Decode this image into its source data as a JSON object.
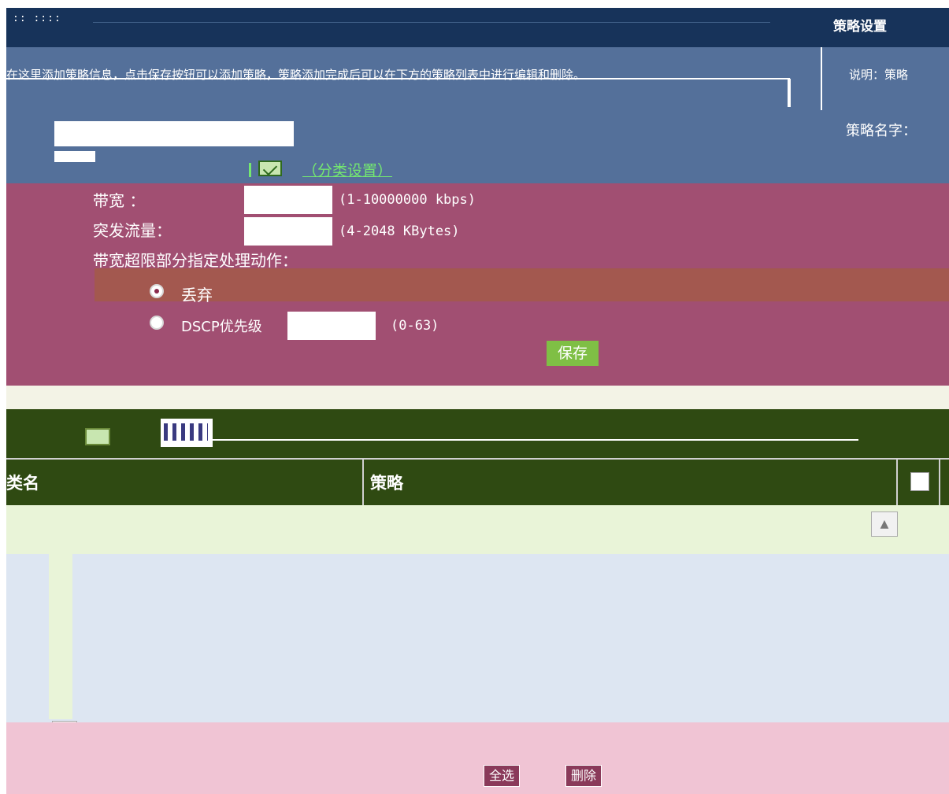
{
  "header": {
    "indicator": ":: ::::",
    "title": "策略设置"
  },
  "description": {
    "text": "在这里添加策略信息，点击保存按钮可以添加策略，策略添加完成后可以在下方的策略列表中进行编辑和删除。",
    "right_text": "说明：策略"
  },
  "form": {
    "right_label": "策略名字：",
    "class_link_label": "（分类设置）",
    "bandwidth_label": "带宽    ：",
    "bandwidth_value": "",
    "bandwidth_hint": "(1-10000000 kbps)",
    "burst_label": "突发流量：",
    "burst_value": "",
    "burst_hint": "(4-2048 KBytes)",
    "action_label": "带宽超限部分指定处理动作：",
    "options": [
      {
        "label": "丢弃",
        "checked": true
      },
      {
        "label": "DSCP优先级",
        "checked": false
      }
    ],
    "dscp_value": "",
    "dscp_hint": "(0-63)",
    "save_label": "保存"
  },
  "table": {
    "columns": [
      "类名",
      "策略"
    ],
    "rows": []
  },
  "footer": {
    "buttons": [
      "全选",
      "删除"
    ]
  }
}
